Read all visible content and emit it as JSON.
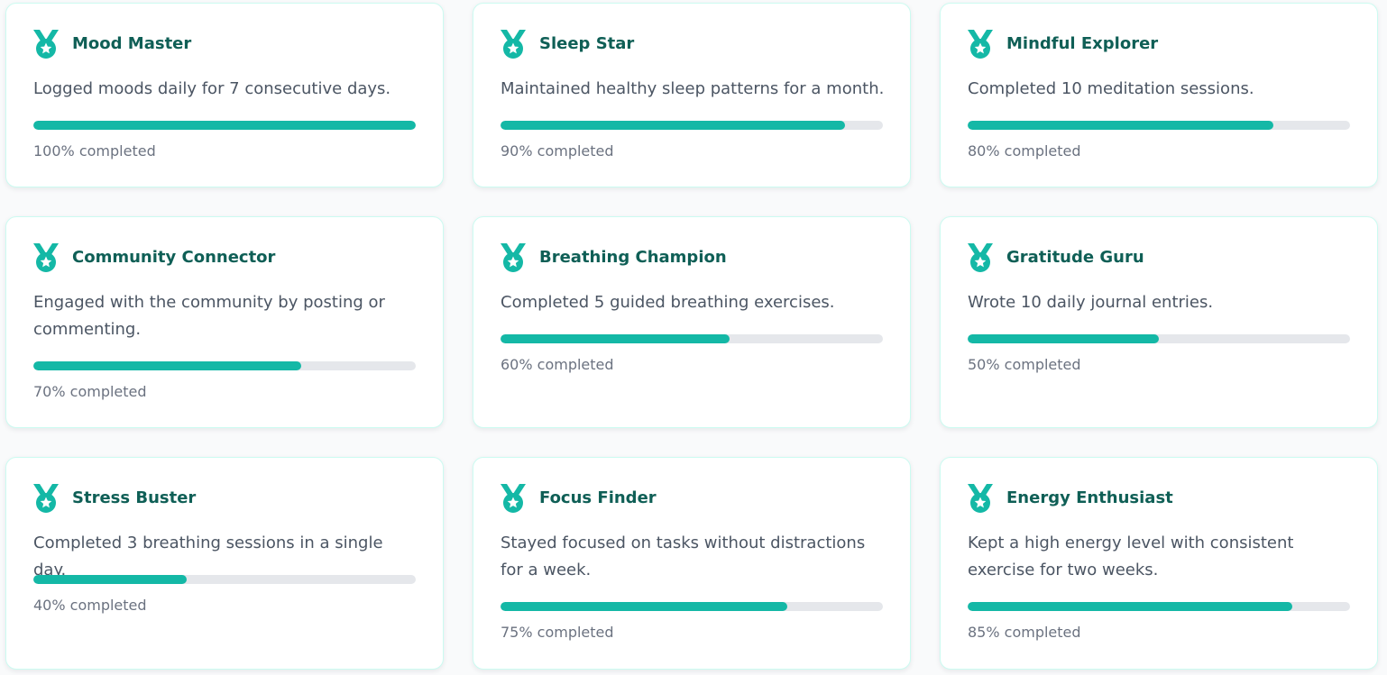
{
  "accent_color": "#14b8a6",
  "progress_suffix": "% completed",
  "achievements": [
    {
      "title": "Mood Master",
      "description": "Logged moods daily for 7 consecutive days.",
      "progress": 100,
      "icon": "medal-icon"
    },
    {
      "title": "Sleep Star",
      "description": "Maintained healthy sleep patterns for a month.",
      "progress": 90,
      "icon": "medal-icon"
    },
    {
      "title": "Mindful Explorer",
      "description": "Completed 10 meditation sessions.",
      "progress": 80,
      "icon": "medal-icon"
    },
    {
      "title": "Community Connector",
      "description": "Engaged with the community by posting or commenting.",
      "progress": 70,
      "icon": "medal-icon"
    },
    {
      "title": "Breathing Champion",
      "description": "Completed 5 guided breathing exercises.",
      "progress": 60,
      "icon": "medal-icon"
    },
    {
      "title": "Gratitude Guru",
      "description": "Wrote 10 daily journal entries.",
      "progress": 50,
      "icon": "medal-icon"
    },
    {
      "title": "Stress Buster",
      "description": "Completed 3 breathing sessions in a single day.",
      "progress": 40,
      "icon": "medal-icon"
    },
    {
      "title": "Focus Finder",
      "description": "Stayed focused on tasks without distractions for a week.",
      "progress": 75,
      "icon": "medal-icon"
    },
    {
      "title": "Energy Enthusiast",
      "description": "Kept a high energy level with consistent exercise for two weeks.",
      "progress": 85,
      "icon": "medal-icon"
    }
  ]
}
